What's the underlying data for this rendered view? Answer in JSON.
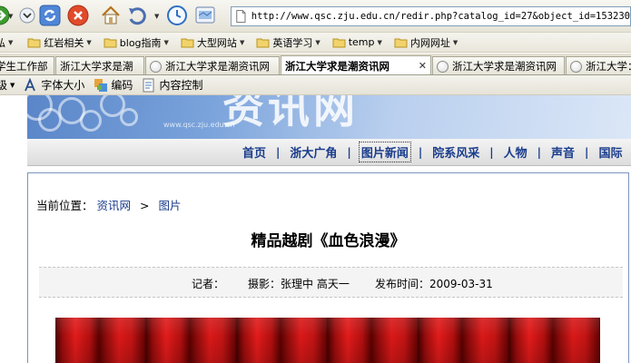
{
  "browser": {
    "address_url": "http://www.qsc.zju.edu.cn/redir.php?catalog_id=27&object_id=153230",
    "bookmarks": [
      {
        "label": "弘"
      },
      {
        "label": "红岩相关"
      },
      {
        "label": "blog指南"
      },
      {
        "label": "大型网站"
      },
      {
        "label": "英语学习"
      },
      {
        "label": "temp"
      },
      {
        "label": "内网网址"
      }
    ],
    "tabs": [
      {
        "label": "学生工作部"
      },
      {
        "label": "浙江大学求是潮"
      },
      {
        "label": "浙江大学求是潮资讯网"
      },
      {
        "label": "浙江大学求是潮资讯网"
      },
      {
        "label": "浙江大学求是潮资讯网"
      },
      {
        "label": "浙江大学：文"
      }
    ],
    "toolbar2": {
      "level": "级",
      "font_size": "字体大小",
      "encoding": "编码",
      "content_control": "内容控制"
    }
  },
  "site": {
    "banner_text": "资讯网",
    "banner_domain": "www.qsc.zju.edu.cn",
    "nav": [
      "首页",
      "浙大广角",
      "图片新闻",
      "院系风采",
      "人物",
      "声音",
      "国际"
    ]
  },
  "article": {
    "breadcrumb_label": "当前位置：",
    "breadcrumb_home": "资讯网",
    "breadcrumb_sep": ">",
    "breadcrumb_section": "图片",
    "title": "精品越剧《血色浪漫》",
    "reporter_label": "记者：",
    "photographer": "摄影：张理中 高天一",
    "date_label": "发布时间：2009-03-31"
  },
  "colors": {
    "nav_link": "#1a3c8c",
    "article_border": "#7b95bf",
    "curtain_red": "#d91818"
  }
}
